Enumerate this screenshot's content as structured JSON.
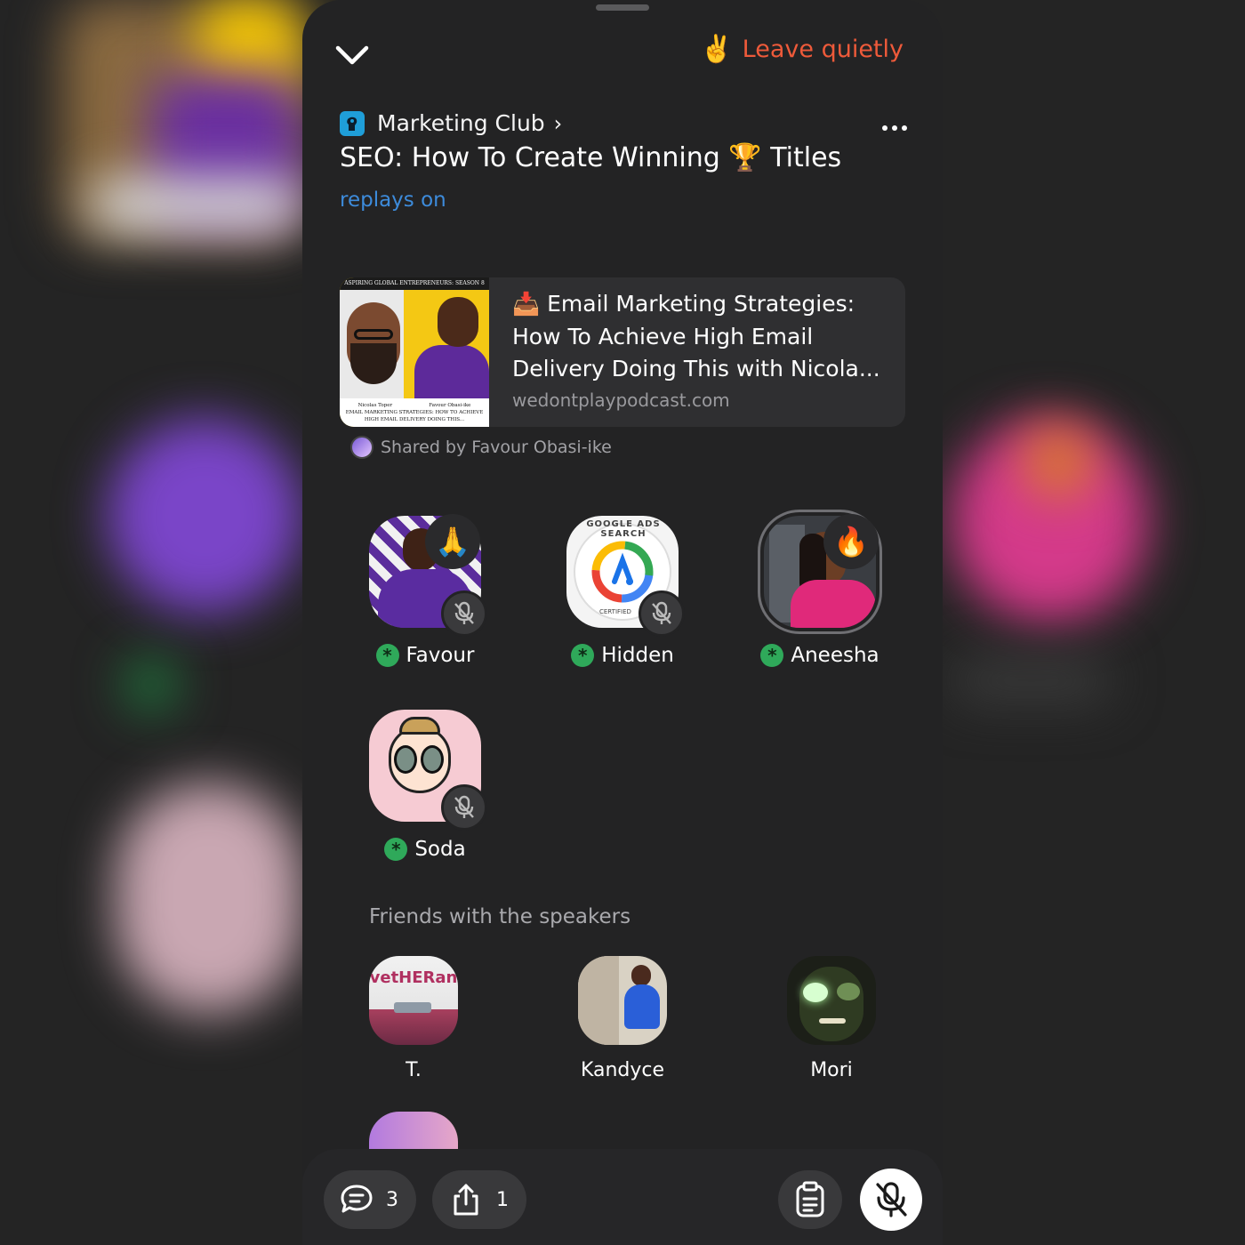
{
  "header": {
    "leave_emoji": "✌️",
    "leave_label": "Leave quietly"
  },
  "room": {
    "club_name": "Marketing Club",
    "title": "SEO: How To Create Winning 🏆 Titles",
    "replays_label": "replays on"
  },
  "shared_link": {
    "title_emoji": "📥",
    "title": "Email Marketing Strategies: How To Achieve High Email Delivery Doing This with Nicola...",
    "domain": "wedontplaypodcast.com",
    "shared_by": "Shared by Favour Obasi-ike",
    "thumb_banner": "ASPIRING GLOBAL ENTREPRENEURS: SEASON 8",
    "thumb_caption_left": "Nicolas Toper",
    "thumb_caption_right": "Favour Obasi-ike",
    "thumb_caption_title": "EMAIL MARKETING STRATEGIES: HOW TO ACHIEVE HIGH EMAIL DELIVERY DOING THIS..."
  },
  "speakers": [
    {
      "name": "Favour",
      "reaction": "🙏",
      "muted": true
    },
    {
      "name": "Hidden",
      "reaction": "",
      "muted": true,
      "logo_text": "GOOGLE ADS SEARCH",
      "logo_sub": "CERTIFIED"
    },
    {
      "name": "Aneesha",
      "reaction": "🔥",
      "muted": false
    },
    {
      "name": "Soda",
      "reaction": "",
      "muted": true
    }
  ],
  "friends_section": {
    "label": "Friends with the speakers",
    "people": [
      {
        "name": "T.",
        "avatar_text": "vetHERan"
      },
      {
        "name": "Kandyce"
      },
      {
        "name": "Mori"
      }
    ]
  },
  "bottom_bar": {
    "chat_count": "3",
    "share_count": "1"
  },
  "colors": {
    "accent_leave": "#ee5a3a",
    "link_blue": "#3d8bdb",
    "club_badge_green": "#2fa95a",
    "panel_bg": "#232324"
  }
}
